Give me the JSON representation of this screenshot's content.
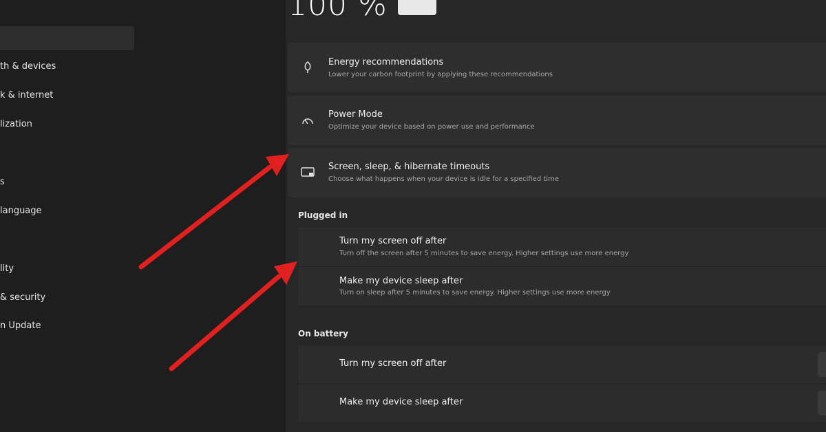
{
  "battery": {
    "percent_text": "100 %"
  },
  "sidebar": {
    "items": [
      {
        "label": "th & devices",
        "icon": "bluetooth-icon"
      },
      {
        "label": "k & internet",
        "icon": "network-icon"
      },
      {
        "label": "lization",
        "icon": "personalization-icon"
      },
      {
        "label": "s",
        "icon": "apps-icon"
      },
      {
        "label": "language",
        "icon": "time-language-icon"
      },
      {
        "label": "lity",
        "icon": "accessibility-icon"
      },
      {
        "label": "& security",
        "icon": "privacy-icon"
      },
      {
        "label": "n Update",
        "icon": "windows-update-icon"
      }
    ]
  },
  "cards": {
    "energy": {
      "title": "Energy recommendations",
      "desc": "Lower your carbon footprint by applying these recommendations",
      "icon": "leaf-icon"
    },
    "power_mode": {
      "title": "Power Mode",
      "desc": "Optimize your device based on power use and performance",
      "icon": "gauge-icon"
    },
    "screen_sleep": {
      "title": "Screen, sleep, & hibernate timeouts",
      "desc": "Choose what happens when your device is idle for a specified time",
      "icon": "monitor-icon"
    }
  },
  "plugged_in": {
    "label": "Plugged in",
    "screen_off": {
      "title": "Turn my screen off after",
      "desc": "Turn off the screen after 5 minutes to save energy. Higher settings use more energy"
    },
    "sleep": {
      "title": "Make my device sleep after",
      "desc": "Turn on sleep after 5 minutes to save energy. Higher settings use more energy"
    }
  },
  "on_battery": {
    "label": "On battery",
    "screen_off": {
      "title": "Turn my screen off after"
    },
    "sleep": {
      "title": "Make my device sleep after"
    }
  },
  "colors": {
    "annotation_arrow": "#e32020",
    "background": "#1f1f1f",
    "card": "#2e2e2e"
  }
}
